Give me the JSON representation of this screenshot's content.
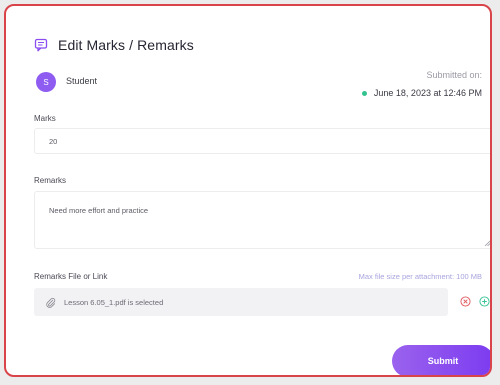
{
  "dialog": {
    "title": "Edit Marks / Remarks"
  },
  "student": {
    "avatar_letter": "S",
    "name": "Student",
    "avatar_color": "#8e5cf0"
  },
  "submission": {
    "label": "Submitted on:",
    "date": "June 18, 2023 at 12:46 PM",
    "status_color": "#34c38f"
  },
  "marks": {
    "label": "Marks",
    "value": "20"
  },
  "remarks": {
    "label": "Remarks",
    "value": "Need more effort and practice"
  },
  "attachment": {
    "label": "Remarks File or Link",
    "max_size_note": "Max file size per attachment: 100 MB",
    "file_text": "Lesson 6.05_1.pdf is selected",
    "paperclip_icon": "paperclip-icon",
    "remove_icon": "remove-circle-icon",
    "add_icon": "add-circle-icon"
  },
  "actions": {
    "submit_label": "Submit",
    "accent": "#8b4cf0",
    "error": "#d9444a",
    "success": "#34c38f"
  }
}
